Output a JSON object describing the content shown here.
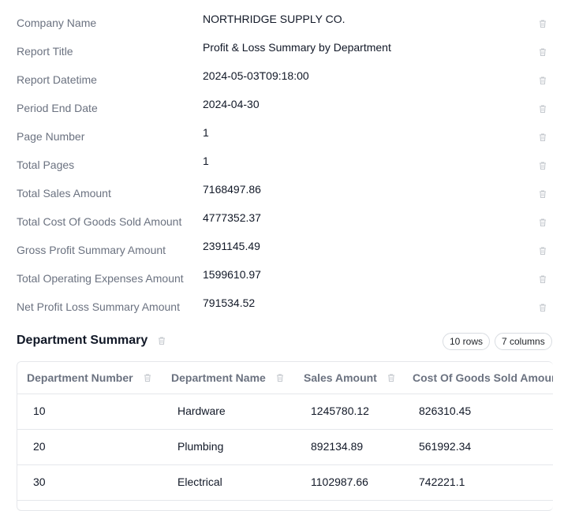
{
  "fields": [
    {
      "label": "Company Name",
      "value": "NORTHRIDGE SUPPLY CO."
    },
    {
      "label": "Report Title",
      "value": "Profit & Loss Summary by Department"
    },
    {
      "label": "Report Datetime",
      "value": "2024-05-03T09:18:00"
    },
    {
      "label": "Period End Date",
      "value": "2024-04-30"
    },
    {
      "label": "Page Number",
      "value": "1"
    },
    {
      "label": "Total Pages",
      "value": "1"
    },
    {
      "label": "Total Sales Amount",
      "value": "7168497.86"
    },
    {
      "label": "Total Cost Of Goods Sold Amount",
      "value": "4777352.37"
    },
    {
      "label": "Gross Profit Summary Amount",
      "value": "2391145.49"
    },
    {
      "label": "Total Operating Expenses Amount",
      "value": "1599610.97"
    },
    {
      "label": "Net Profit Loss Summary Amount",
      "value": "791534.52"
    }
  ],
  "section": {
    "title": "Department Summary",
    "rows_badge": "10 rows",
    "columns_badge": "7 columns"
  },
  "table": {
    "headers": [
      "Department Number",
      "Department Name",
      "Sales Amount",
      "Cost Of Goods Sold Amount"
    ],
    "rows": [
      [
        "10",
        "Hardware",
        "1245780.12",
        "826310.45"
      ],
      [
        "20",
        "Plumbing",
        "892134.89",
        "561992.34"
      ],
      [
        "30",
        "Electrical",
        "1102987.66",
        "742221.1"
      ]
    ]
  },
  "icons": {
    "delete": "trash-icon"
  }
}
